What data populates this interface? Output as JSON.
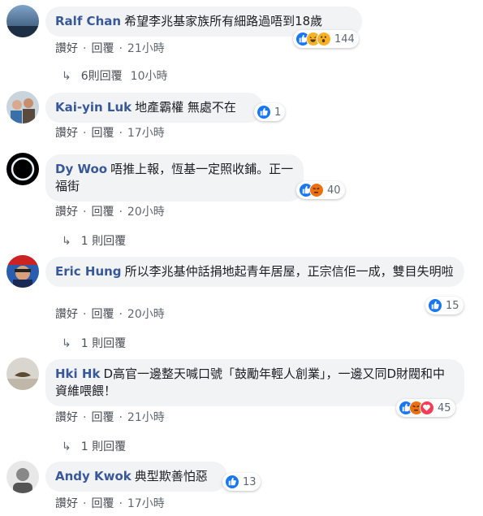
{
  "actions": {
    "like": "讚好",
    "reply": "回覆",
    "dot": "·"
  },
  "comments": [
    {
      "author": "Ralf Chan",
      "text": "希望李兆基家族所有細路過唔到18歲",
      "reactions": [
        "like",
        "haha",
        "wow"
      ],
      "reaction_count": "144",
      "time": "21小時",
      "replies": {
        "label": "6則回覆",
        "time": "10小時"
      }
    },
    {
      "author": "Kai-yin Luk",
      "text": "地產霸權 無處不在",
      "reactions": [
        "like"
      ],
      "reaction_count": "1",
      "time": "17小時"
    },
    {
      "author": "Dy Woo",
      "text": "唔推上報，恆基一定照收鋪。正一福街",
      "reactions": [
        "like",
        "angry"
      ],
      "reaction_count": "40",
      "time": "20小時",
      "replies": {
        "label": "1 則回覆"
      }
    },
    {
      "author": "Eric Hung",
      "text": "所以李兆基仲話捐地起青年居屋，正宗信佢一成，雙目失明啦",
      "reactions": [
        "like"
      ],
      "reaction_count": "15",
      "time": "20小時",
      "replies": {
        "label": "1 則回覆"
      }
    },
    {
      "author": "Hki Hk",
      "text": "D高官一邊整天喊口號「鼓勵年輕人創業」，一邊又同D財閥和中資維喂餵！",
      "reactions": [
        "like",
        "angry",
        "love"
      ],
      "reaction_count": "45",
      "time": "21小時",
      "replies": {
        "label": "1 則回覆"
      }
    },
    {
      "author": "Andy Kwok",
      "text": "典型欺善怕惡",
      "reactions": [
        "like"
      ],
      "reaction_count": "13",
      "time": "17小時"
    }
  ]
}
